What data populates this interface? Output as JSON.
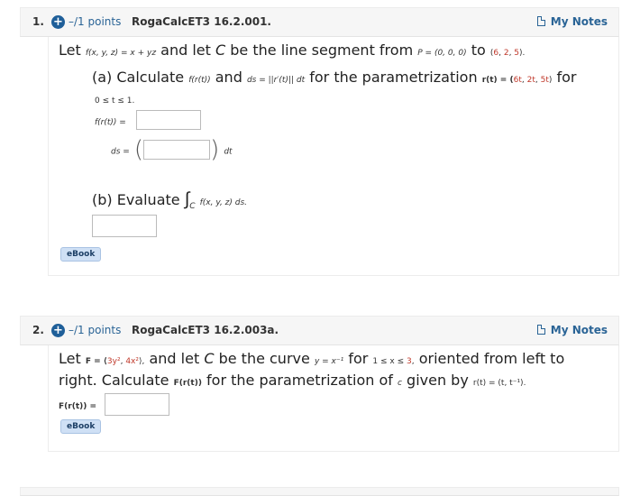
{
  "questions": [
    {
      "number": "1.",
      "points": "–/1 points",
      "source": "RogaCalcET3 16.2.001.",
      "my_notes": "My Notes",
      "icons": {
        "expand": "plus-circle-icon",
        "notes": "note-document-icon"
      },
      "intro": {
        "let": "Let",
        "f_def": "f(x, y, z) = x + yz",
        "and_let": "and let",
        "C": "C",
        "be_line": "be the line segment from",
        "P": "P = (0, 0, 0)",
        "to": "to",
        "end_open": "(",
        "end_vals": [
          "6",
          "2",
          "5"
        ],
        "end_close": ")."
      },
      "part_a": {
        "label": "(a) Calculate",
        "f_r": "f(r(t))",
        "and": "and",
        "ds_expr": "ds = ||r′(t)|| dt",
        "for_param": "for the parametrization",
        "r_def_prefix": "r(t) = (",
        "r_vals": [
          "6t",
          "2t",
          "5t"
        ],
        "r_def_suffix": ")",
        "for": "for",
        "range": "0 ≤ t ≤ 1.",
        "f_r_label": "f(r(t)) =",
        "f_r_value": "",
        "ds_label": "ds =",
        "ds_value": "",
        "dt": "dt"
      },
      "part_b": {
        "label": "(b) Evaluate",
        "integral": "∫",
        "sub": "C",
        "integrand": "f(x, y, z) ds.",
        "value": ""
      },
      "ebook": "eBook"
    },
    {
      "number": "2.",
      "points": "–/1 points",
      "source": "RogaCalcET3 16.2.003a.",
      "my_notes": "My Notes",
      "text": {
        "let": "Let",
        "F_prefix": "F = ⟨",
        "F_vals": [
          "3y²",
          "4x²"
        ],
        "F_suffix": "⟩,",
        "and_let": "and let",
        "C": "C",
        "be_curve": "be the curve",
        "curve": "y = x⁻¹",
        "for": "for",
        "range_prefix": "1 ≤ x ≤",
        "range_end": "3",
        "range_suffix": ",",
        "oriented": "oriented from left to",
        "right": "right. Calculate",
        "F_r": "F(r(t))",
        "for_param": "for the parametrization of",
        "c": "c",
        "given_by": "given by",
        "r_def": "r(t) = (t, t⁻¹)."
      },
      "answer_label": "F(r(t)) =",
      "answer_value": "",
      "ebook": "eBook"
    }
  ]
}
